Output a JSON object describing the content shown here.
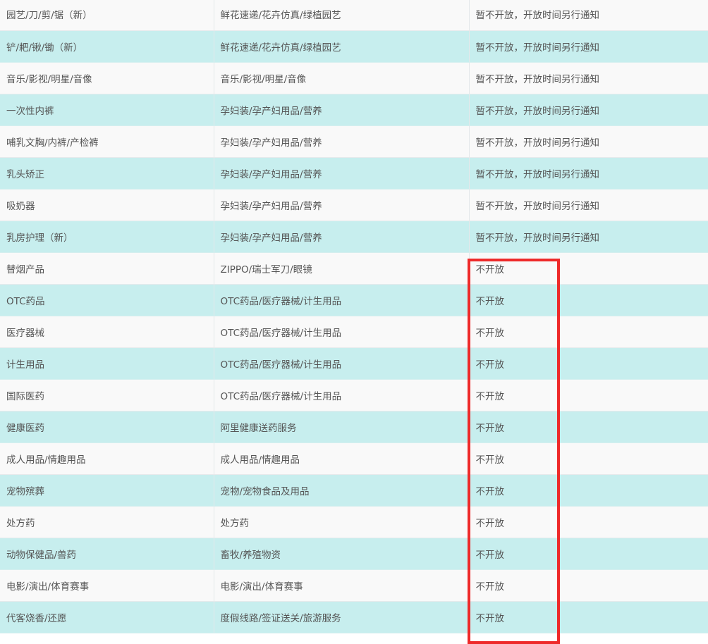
{
  "table": {
    "rows": [
      {
        "category": "园艺/刀/剪/锯（新）",
        "industry": "鲜花速递/花卉仿真/绿植园艺",
        "status": "暂不开放，开放时间另行通知"
      },
      {
        "category": "铲/耙/锹/锄（新）",
        "industry": "鲜花速递/花卉仿真/绿植园艺",
        "status": "暂不开放，开放时间另行通知"
      },
      {
        "category": "音乐/影视/明星/音像",
        "industry": "音乐/影视/明星/音像",
        "status": "暂不开放，开放时间另行通知"
      },
      {
        "category": "一次性内裤",
        "industry": "孕妇装/孕产妇用品/营养",
        "status": "暂不开放，开放时间另行通知"
      },
      {
        "category": "哺乳文胸/内裤/产检裤",
        "industry": "孕妇装/孕产妇用品/营养",
        "status": "暂不开放，开放时间另行通知"
      },
      {
        "category": "乳头矫正",
        "industry": "孕妇装/孕产妇用品/营养",
        "status": "暂不开放，开放时间另行通知"
      },
      {
        "category": "吸奶器",
        "industry": "孕妇装/孕产妇用品/营养",
        "status": "暂不开放，开放时间另行通知"
      },
      {
        "category": "乳房护理（新）",
        "industry": "孕妇装/孕产妇用品/营养",
        "status": "暂不开放，开放时间另行通知"
      },
      {
        "category": "替烟产品",
        "industry": "ZIPPO/瑞士军刀/眼镜",
        "status": "不开放"
      },
      {
        "category": "OTC药品",
        "industry": "OTC药品/医疗器械/计生用品",
        "status": "不开放"
      },
      {
        "category": "医疗器械",
        "industry": "OTC药品/医疗器械/计生用品",
        "status": "不开放"
      },
      {
        "category": "计生用品",
        "industry": "OTC药品/医疗器械/计生用品",
        "status": "不开放"
      },
      {
        "category": "国际医药",
        "industry": "OTC药品/医疗器械/计生用品",
        "status": "不开放"
      },
      {
        "category": "健康医药",
        "industry": "阿里健康送药服务",
        "status": "不开放"
      },
      {
        "category": "成人用品/情趣用品",
        "industry": "成人用品/情趣用品",
        "status": "不开放"
      },
      {
        "category": "宠物殡葬",
        "industry": "宠物/宠物食品及用品",
        "status": "不开放"
      },
      {
        "category": "处方药",
        "industry": "处方药",
        "status": "不开放"
      },
      {
        "category": "动物保健品/兽药",
        "industry": "畜牧/养殖物资",
        "status": "不开放"
      },
      {
        "category": "电影/演出/体育赛事",
        "industry": "电影/演出/体育赛事",
        "status": "不开放"
      },
      {
        "category": "代客烧香/还愿",
        "industry": "度假线路/签证送关/旅游服务",
        "status": "不开放"
      }
    ]
  },
  "colors": {
    "row_odd": "#f9f9f9",
    "row_even": "#c7eeee",
    "text": "#555555",
    "highlight_border": "#ee2a2a"
  }
}
